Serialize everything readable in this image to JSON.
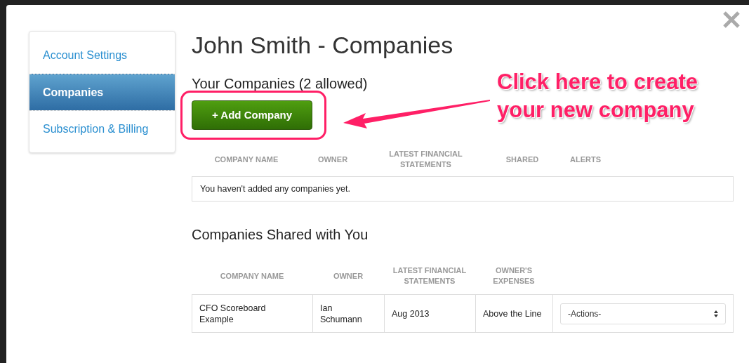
{
  "sidebar": {
    "items": [
      {
        "label": "Account Settings",
        "selected": false
      },
      {
        "label": "Companies",
        "selected": true
      },
      {
        "label": "Subscription & Billing",
        "selected": false
      }
    ]
  },
  "title": "John Smith - Companies",
  "your_companies": {
    "heading": "Your Companies (2 allowed)",
    "add_button": "+ Add Company",
    "columns": [
      "COMPANY NAME",
      "OWNER",
      "LATEST FINANCIAL STATEMENTS",
      "SHARED",
      "ALERTS"
    ],
    "empty_message": "You haven't added any companies yet."
  },
  "shared": {
    "heading": "Companies Shared with You",
    "columns": [
      "COMPANY NAME",
      "OWNER",
      "LATEST FINANCIAL STATEMENTS",
      "OWNER'S EXPENSES"
    ],
    "rows": [
      {
        "cells": [
          "CFO Scoreboard Example",
          "Ian Schumann",
          "Aug 2013",
          "Above the Line"
        ],
        "action": "-Actions-"
      }
    ]
  },
  "callout": "Click here to create your new company"
}
